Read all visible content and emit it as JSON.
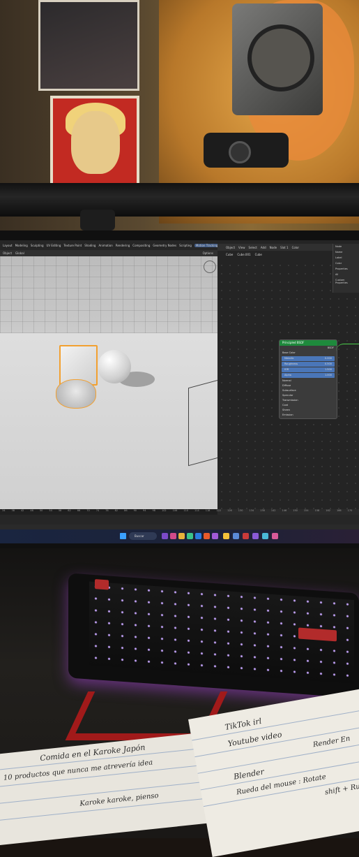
{
  "blender": {
    "workspace_tabs": [
      "Layout",
      "Modeling",
      "Sculpting",
      "UV Editing",
      "Texture Paint",
      "Shading",
      "Animation",
      "Rendering",
      "Compositing",
      "Geometry Nodes",
      "Scripting",
      "Motion Tracking"
    ],
    "active_tab": "Motion Tracking",
    "viewport_header": [
      "Object",
      "Global"
    ],
    "viewport_overlay": "Options",
    "node_header": [
      "Object",
      "View",
      "Select",
      "Add",
      "Node",
      "Slot 1",
      "Color"
    ],
    "node_breadcrumb": [
      "Cube",
      "Cube.001",
      "Cube"
    ],
    "sidebar": [
      "Node",
      "Name",
      "Label",
      "Color",
      "Properties",
      "All",
      "Custom Properties"
    ],
    "principled_node": {
      "title": "Principled BSDF",
      "output": "BSDF",
      "rows": [
        {
          "label": "Base Color",
          "value": ""
        },
        {
          "label": "Metallic",
          "value": "0.000"
        },
        {
          "label": "Roughness",
          "value": "0.500"
        },
        {
          "label": "IOR",
          "value": "1.500"
        },
        {
          "label": "Alpha",
          "value": "1.000"
        },
        {
          "label": "Normal",
          "value": ""
        },
        {
          "label": "Diffuse",
          "value": ""
        },
        {
          "label": "Subsurface",
          "value": ""
        },
        {
          "label": "Specular",
          "value": ""
        },
        {
          "label": "Transmission",
          "value": ""
        },
        {
          "label": "Coat",
          "value": ""
        },
        {
          "label": "Sheen",
          "value": ""
        },
        {
          "label": "Emission",
          "value": ""
        },
        {
          "label": "Thin Film",
          "value": ""
        }
      ]
    },
    "timeline_ticks": [
      "34",
      "38",
      "42",
      "46",
      "50",
      "54",
      "58",
      "62",
      "66",
      "70",
      "74",
      "78",
      "82",
      "86",
      "90",
      "94",
      "98",
      "102",
      "106",
      "110",
      "114",
      "118",
      "122",
      "126",
      "130",
      "134",
      "138",
      "142",
      "146",
      "150",
      "154",
      "158",
      "162",
      "166",
      "170",
      "174",
      "178",
      "182",
      "186",
      "190",
      "194",
      "198",
      "202",
      "206",
      "210",
      "214",
      "218",
      "222",
      "226",
      "230"
    ]
  },
  "taskbar": {
    "search_label": "Buscar"
  },
  "notebook": {
    "left_lines": [
      "Comida en el Karoke     Japón",
      "10 productos  que nunca me atrevería idea",
      "Karoke   karoke, pienso"
    ],
    "right_lines": [
      "TikTok irl",
      "Youtube video",
      "Blender",
      "Rueda del mouse : Rotate",
      "Render En",
      "shift + Rue"
    ]
  },
  "colors": {
    "selection_outline": "#f2a030",
    "node_header": "#1e8a3c",
    "keyboard_glow": "#c7a6ff",
    "poster_red": "#c22a22"
  }
}
